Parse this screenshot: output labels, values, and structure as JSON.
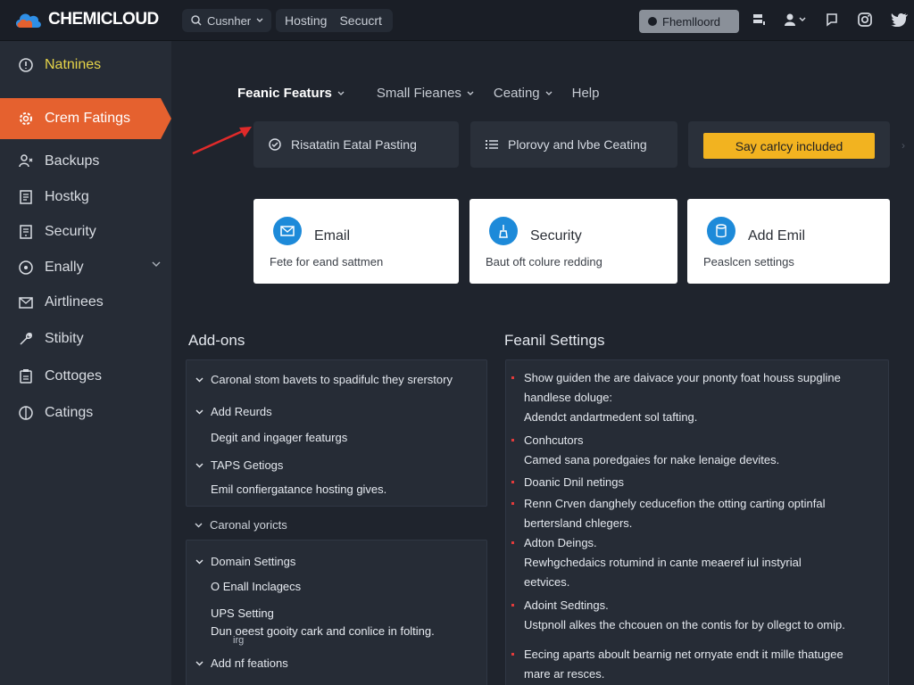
{
  "brand": {
    "name": "CHEMICLOUD"
  },
  "topbar": {
    "search_label": "Cusnher",
    "nav": [
      "Hosting",
      "Secucrt"
    ],
    "account_label": "Fhemlloord",
    "icons": [
      "server-icon",
      "user-icon",
      "chat-icon",
      "instagram-icon",
      "twitter-icon"
    ]
  },
  "sidebar": {
    "items": [
      {
        "label": "Natnines",
        "icon": "badge-icon",
        "style": "yellow"
      },
      {
        "label": "Crem Fatings",
        "icon": "gear-icon",
        "style": "active"
      },
      {
        "label": "Backups",
        "icon": "backup-icon",
        "style": "normal"
      },
      {
        "label": "Hostkg",
        "icon": "hosting-icon",
        "style": "normal"
      },
      {
        "label": "Security",
        "icon": "security-icon",
        "style": "normal"
      },
      {
        "label": "Enally",
        "icon": "globe-icon",
        "style": "normal",
        "expandable": true
      },
      {
        "label": "Airtlinees",
        "icon": "mail-icon",
        "style": "normal"
      },
      {
        "label": "Stibity",
        "icon": "wrench-icon",
        "style": "normal"
      },
      {
        "label": "Cottoges",
        "icon": "clipboard-icon",
        "style": "normal"
      },
      {
        "label": "Catings",
        "icon": "globe-icon",
        "style": "normal"
      }
    ]
  },
  "mainnav": {
    "items": [
      {
        "label": "Feanic Featurs",
        "dropdown": true
      },
      {
        "label": "Small Fieanes",
        "dropdown": true
      },
      {
        "label": "Ceating",
        "dropdown": true
      },
      {
        "label": "Help",
        "dropdown": false
      }
    ]
  },
  "quickbar": {
    "card1": "Risatatin Eatal Pasting",
    "card2": "Plorovy and lvbe Ceating",
    "promo": "Say carlcy included"
  },
  "features": [
    {
      "title": "Email",
      "desc": "Fete for eand sattmen",
      "icon": "email-icon"
    },
    {
      "title": "Security",
      "desc": "Baut oft colure redding",
      "icon": "security-icon"
    },
    {
      "title": "Add Emil",
      "desc": "Peaslcen settings",
      "icon": "database-icon"
    }
  ],
  "addons": {
    "title": "Add-ons",
    "panel1": {
      "header": "Caronal stom bavets to spadifulc they srerstory",
      "items": [
        {
          "heading": "Add Reurds",
          "text": "Degit and ingager featurgs"
        },
        {
          "heading": "TAPS Getiogs",
          "text": "Emil confiergatance hosting gives."
        }
      ]
    },
    "standalone": "Caronal yoricts",
    "panel2": {
      "items": [
        {
          "heading": "Domain Settings",
          "text": "O Enall Inclagecs"
        },
        {
          "heading": "UPS Setting",
          "text": "Dun oeest gooity cark and conlice in folting."
        },
        {
          "heading": "Add nf feations",
          "text": ""
        }
      ],
      "overflow_text": "irg"
    }
  },
  "settings": {
    "title": "Feanil Settings",
    "items": [
      {
        "head": "Show guiden the are daivace your pnonty foat houss supgline",
        "body": "handlese doluge:\nAdendct andartmedent sol tafting."
      },
      {
        "head": "Conhcutors",
        "body": "Camed sana poredgaies for nake lenaige devites."
      },
      {
        "head": "Doanic Dnil netings",
        "body": ""
      },
      {
        "head": "Renn Crven danghely ceducefion the otting carting optinfal",
        "body": "bertersland chlegers."
      },
      {
        "head": "Adton Deings.",
        "body": "Rewhgchedaics rotumind in cante meaeref iul instyrial\neetvices."
      },
      {
        "head": "Adoint Sedtings.",
        "body": "Ustpnoll alkes the chcouen on the contis for by ollegct to omip."
      },
      {
        "head": "Eecing aparts aboult bearnig net ornyate endt it mille thatugee",
        "body": "mare ar resces."
      }
    ]
  },
  "colors": {
    "accent": "#e5612f",
    "promo": "#f2b320",
    "icon_blue": "#1d8ad9",
    "bullet_red": "#e23b3b"
  }
}
